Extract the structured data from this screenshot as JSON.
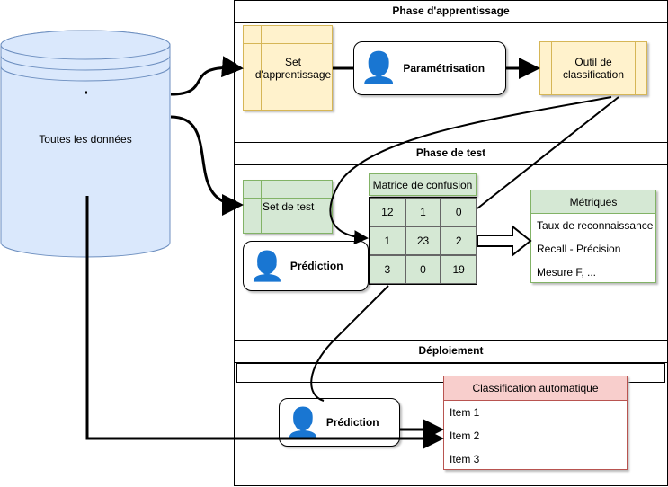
{
  "database": {
    "label": "Toutes les données"
  },
  "phases": [
    {
      "title": "Phase d'apprentissage"
    },
    {
      "title": "Phase de test"
    },
    {
      "title": "Déploiement"
    }
  ],
  "training": {
    "set": "Set d'apprentissage",
    "process": "Paramétrisation",
    "tool": "Outil de classification"
  },
  "test": {
    "set": "Set de test",
    "process": "Prédiction",
    "matrix_title": "Matrice de confusion",
    "matrix": [
      [
        "12",
        "1",
        "0"
      ],
      [
        "1",
        "23",
        "2"
      ],
      [
        "3",
        "0",
        "19"
      ]
    ],
    "metrics_title": "Métriques",
    "metrics": [
      "Taux de reconnaissance",
      "Recall - Précision",
      "Mesure F, ..."
    ]
  },
  "deploy": {
    "process": "Prédiction",
    "output_title": "Classification automatique",
    "items": [
      "Item 1",
      "Item 2",
      "Item 3"
    ]
  },
  "colors": {
    "yellow": "#fff2cc",
    "green": "#d5e8d4",
    "red": "#f8cecc",
    "blue": "#dae8fc"
  }
}
